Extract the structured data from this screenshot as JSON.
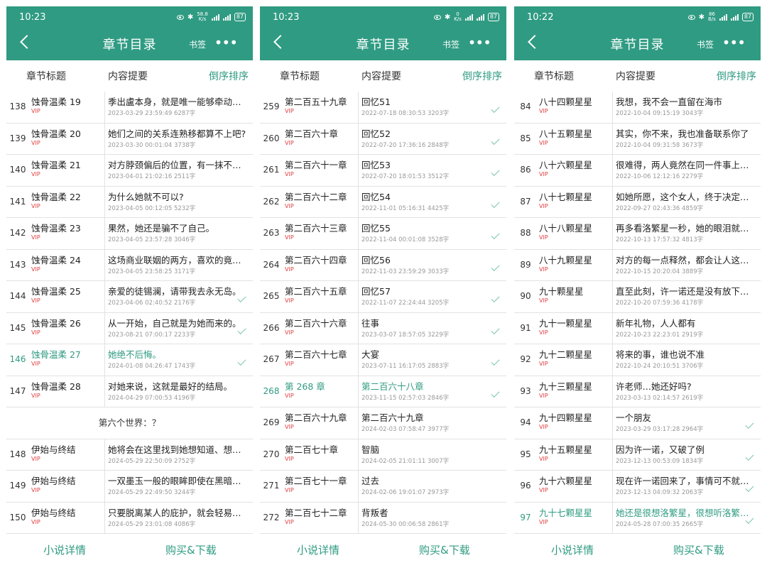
{
  "colors": {
    "accent": "#2f9b82",
    "vip": "#e23c3c"
  },
  "phones": [
    {
      "status": {
        "time": "10:23",
        "speed_top": "58.8",
        "speed_bottom": "K/s",
        "battery": "87"
      },
      "nav": {
        "title": "章节目录",
        "bookmark": "书签",
        "more": "•••"
      },
      "cols": {
        "title": "章节标题",
        "summary": "内容提要",
        "sort": "倒序排序"
      },
      "rows": [
        {
          "num": "138",
          "title": "蚀骨温柔  19",
          "vip": "VIP",
          "summary": "季出盧本身，就是唯一能够牵动她本…",
          "meta": "2023-03-29 23:59:49  6287字",
          "check": false,
          "active": false
        },
        {
          "num": "139",
          "title": "蚀骨温柔  20",
          "vip": "VIP",
          "summary": "她们之间的关系连熟移都算不上吧?",
          "meta": "2023-03-30 00:01:04  3738字",
          "check": false,
          "active": false
        },
        {
          "num": "140",
          "title": "蚀骨温柔  21",
          "vip": "VIP",
          "summary": "对方脖颈偏后的位置，有一抹不太明…",
          "meta": "2023-04-01 21:02:16  2511字",
          "check": false,
          "active": false
        },
        {
          "num": "141",
          "title": "蚀骨温柔  22",
          "vip": "VIP",
          "summary": "为什么她就不可以?",
          "meta": "2023-04-05 00:12:05  5232字",
          "check": false,
          "active": false
        },
        {
          "num": "142",
          "title": "蚀骨温柔  23",
          "vip": "VIP",
          "summary": "果然，她还是骗不了自己。",
          "meta": "2023-04-05 23:57:28  3046字",
          "check": false,
          "active": false
        },
        {
          "num": "143",
          "title": "蚀骨温柔  24",
          "vip": "VIP",
          "summary": "这场商业联姻的两方，喜欢的竟然都…",
          "meta": "2023-04-05 23:58:25  3171字",
          "check": false,
          "active": false
        },
        {
          "num": "144",
          "title": "蚀骨温柔  25",
          "vip": "VIP",
          "summary": "亲爱的徒锡澜，请带我去永无岛。",
          "meta": "2023-04-06 02:40:52  2176字",
          "check": true,
          "active": false
        },
        {
          "num": "145",
          "title": "蚀骨温柔  26",
          "vip": "VIP",
          "summary": "从一开始，自己就是为她而来的。",
          "meta": "2023-08-21 07:00:17  2233字",
          "check": true,
          "active": false
        },
        {
          "num": "146",
          "title": "蚀骨温柔  27",
          "vip": "VIP",
          "summary": "她绝不后悔。",
          "meta": "2024-01-08 04:26:47  1743字",
          "check": true,
          "active": true
        },
        {
          "num": "147",
          "title": "蚀骨温柔  28",
          "vip": "VIP",
          "summary": "对她来说，这就是最好的结局。",
          "meta": "2024-04-29 07:00:53  4196字",
          "check": false,
          "active": false
        },
        {
          "volume": "第六个世界：？"
        },
        {
          "num": "148",
          "title": "伊始与终结",
          "vip": "VIP",
          "summary": "她将会在这里找到她想知道、想记起…",
          "meta": "2024-05-29 22:50:09  2752字",
          "check": false,
          "active": false
        },
        {
          "num": "149",
          "title": "伊始与终结",
          "vip": "VIP",
          "summary": "一双墨玉一般的眼眸即使在黑暗中仍…",
          "meta": "2024-05-29 22:49:50  3244字",
          "check": false,
          "active": false
        },
        {
          "num": "150",
          "title": "伊始与终结",
          "vip": "VIP",
          "summary": "只要脱离某人的庇护，就会轻易洞穿…",
          "meta": "2024-05-29 23:01:08  4086字",
          "check": false,
          "active": false
        }
      ],
      "footer": {
        "detail": "小说详情",
        "buy": "购买&下载"
      }
    },
    {
      "status": {
        "time": "10:23",
        "speed_top": "0",
        "speed_bottom": "K/s",
        "battery": "87"
      },
      "nav": {
        "title": "章节目录",
        "bookmark": "书签",
        "more": "•••"
      },
      "cols": {
        "title": "章节标题",
        "summary": "内容提要",
        "sort": "倒序排序"
      },
      "rows": [
        {
          "num": "259",
          "title": "第二百五十九章",
          "vip": "VIP",
          "summary": "回忆51",
          "meta": "2022-07-18 08:30:53  3203字",
          "check": true,
          "active": false
        },
        {
          "num": "260",
          "title": "第二百六十章",
          "vip": "VIP",
          "summary": " 回忆52",
          "meta": "2022-07-20 17:36:16  2848字",
          "check": true,
          "active": false
        },
        {
          "num": "261",
          "title": "第二百六十一章",
          "vip": "VIP",
          "summary": "回忆53",
          "meta": "2022-07-20 18:01:53  3512字",
          "check": true,
          "active": false
        },
        {
          "num": "262",
          "title": "第二百六十二章",
          "vip": "VIP",
          "summary": " 回忆54",
          "meta": "2022-11-01 05:16:31  4425字",
          "check": true,
          "active": false
        },
        {
          "num": "263",
          "title": "第二百六十三章",
          "vip": "VIP",
          "summary": "回忆55",
          "meta": "2022-11-04 00:01:08  3528字",
          "check": true,
          "active": false
        },
        {
          "num": "264",
          "title": "第二百六十四章",
          "vip": "VIP",
          "summary": " 回忆56",
          "meta": "2022-11-03 23:59:29  3033字",
          "check": true,
          "active": false
        },
        {
          "num": "265",
          "title": "第二百六十五章",
          "vip": "VIP",
          "summary": "回忆57",
          "meta": "2022-11-07 22:24:44  3205字",
          "check": true,
          "active": false
        },
        {
          "num": "266",
          "title": "第二百六十六章",
          "vip": "VIP",
          "summary": "往事",
          "meta": "2023-03-07 18:57:05  3229字",
          "check": true,
          "active": false
        },
        {
          "num": "267",
          "title": "第二百六十七章",
          "vip": "VIP",
          "summary": "大宴",
          "meta": "2023-07-11 16:17:05  2883字",
          "check": true,
          "active": false
        },
        {
          "num": "268",
          "title": "第 268 章",
          "vip": "VIP",
          "summary": "第二百六十八章",
          "meta": "2023-11-15 02:57:03  2846字",
          "check": true,
          "active": true
        },
        {
          "num": "269",
          "title": "第二百六十九章",
          "vip": "VIP",
          "summary": "第二百六十九章",
          "meta": "2024-02-03 07:58:47  3977字",
          "check": false,
          "active": false
        },
        {
          "num": "270",
          "title": "第二百七十章",
          "vip": "VIP",
          "summary": "智脑",
          "meta": "2024-02-05 21:01:11  3007字",
          "check": false,
          "active": false
        },
        {
          "num": "271",
          "title": "第二百七十一章",
          "vip": "VIP",
          "summary": "过去",
          "meta": "2024-02-06 19:01:07  2973字",
          "check": false,
          "active": false
        },
        {
          "num": "272",
          "title": "第二百七十二章",
          "vip": "VIP",
          "summary": "背叛者",
          "meta": "2024-05-30 00:06:58  2861字",
          "check": false,
          "active": false
        }
      ],
      "footer": {
        "detail": "小说详情",
        "buy": "购买&下载"
      }
    },
    {
      "status": {
        "time": "10:22",
        "speed_top": "86",
        "speed_bottom": "B/s",
        "battery": "87"
      },
      "nav": {
        "title": "章节目录",
        "bookmark": "书签",
        "more": "•••"
      },
      "cols": {
        "title": "章节标题",
        "summary": "内容提要",
        "sort": "倒序排序"
      },
      "rows": [
        {
          "num": "84",
          "title": "八十四颗星星",
          "vip": "VIP",
          "summary": "我想，我不会一直留在海市",
          "meta": "2022-10-04 09:15:19  3043字",
          "check": false,
          "active": false
        },
        {
          "num": "85",
          "title": "八十五颗星星",
          "vip": "VIP",
          "summary": "其实，你不来，我也准备联系你了",
          "meta": "2022-10-04 09:31:58  3673字",
          "check": false,
          "active": false
        },
        {
          "num": "86",
          "title": "八十六颗星星",
          "vip": "VIP",
          "summary": "很难得，两人竟然在同一件事上这么…",
          "meta": "2022-10-06 12:12:16  2279字",
          "check": false,
          "active": false
        },
        {
          "num": "87",
          "title": "八十七颗星星",
          "vip": "VIP",
          "summary": "如她所愿，这个女人，终于决定放过…",
          "meta": "2022-09-27 02:43:36  4859字",
          "check": false,
          "active": false
        },
        {
          "num": "88",
          "title": "八十八颗星星",
          "vip": "VIP",
          "summary": "再多看洛繁星一秒，她的眼泪就会流…",
          "meta": "2022-10-13 17:57:32  4813字",
          "check": false,
          "active": false
        },
        {
          "num": "89",
          "title": "八十九颗星星",
          "vip": "VIP",
          "summary": "对方的每一点释然，都会让人这么难过",
          "meta": "2022-10-15 20:20:04  3889字",
          "check": false,
          "active": false
        },
        {
          "num": "90",
          "title": "九十颗星星",
          "vip": "VIP",
          "summary": "直至此刻，许一诺还是没有放下洛繁星",
          "meta": "2022-10-20 07:59:36  4178字",
          "check": false,
          "active": false
        },
        {
          "num": "91",
          "title": "九十一颗星星",
          "vip": "VIP",
          "summary": "新年礼物，人人都有",
          "meta": "2022-10-23 22:23:01  2919字",
          "check": false,
          "active": false
        },
        {
          "num": "92",
          "title": "九十二颗星星",
          "vip": "VIP",
          "summary": "将来的事，谁也说不准",
          "meta": "2022-10-24 20:10:51  3706字",
          "check": false,
          "active": false
        },
        {
          "num": "93",
          "title": "九十三颗星星",
          "vip": "VIP",
          "summary": "许老师…她还好吗?",
          "meta": "2023-03-13 02:14:57  2619字",
          "check": false,
          "active": false
        },
        {
          "num": "94",
          "title": "九十四颗星星",
          "vip": "VIP",
          "summary": "一个朋友",
          "meta": "2023-03-29 03:17:28  2964字",
          "check": true,
          "active": false
        },
        {
          "num": "95",
          "title": "九十五颗星星",
          "vip": "VIP",
          "summary": "因为许一诺，又破了例",
          "meta": "2023-12-13 00:53:09  1834字",
          "check": true,
          "active": false
        },
        {
          "num": "96",
          "title": "九十六颗星星",
          "vip": "VIP",
          "summary": "现在许一诺回来了，事情可不就不一…",
          "meta": "2023-12-13 04:09:32  2063字",
          "check": true,
          "active": false
        },
        {
          "num": "97",
          "title": "九十七颗星星",
          "vip": "VIP",
          "summary": "她还是很想洛繁星，很想听洛繁星…",
          "meta": "2024-05-28 07:00:35  2665字",
          "check": true,
          "active": true
        }
      ],
      "footer": {
        "detail": "小说详情",
        "buy": "购买&下载"
      }
    }
  ]
}
